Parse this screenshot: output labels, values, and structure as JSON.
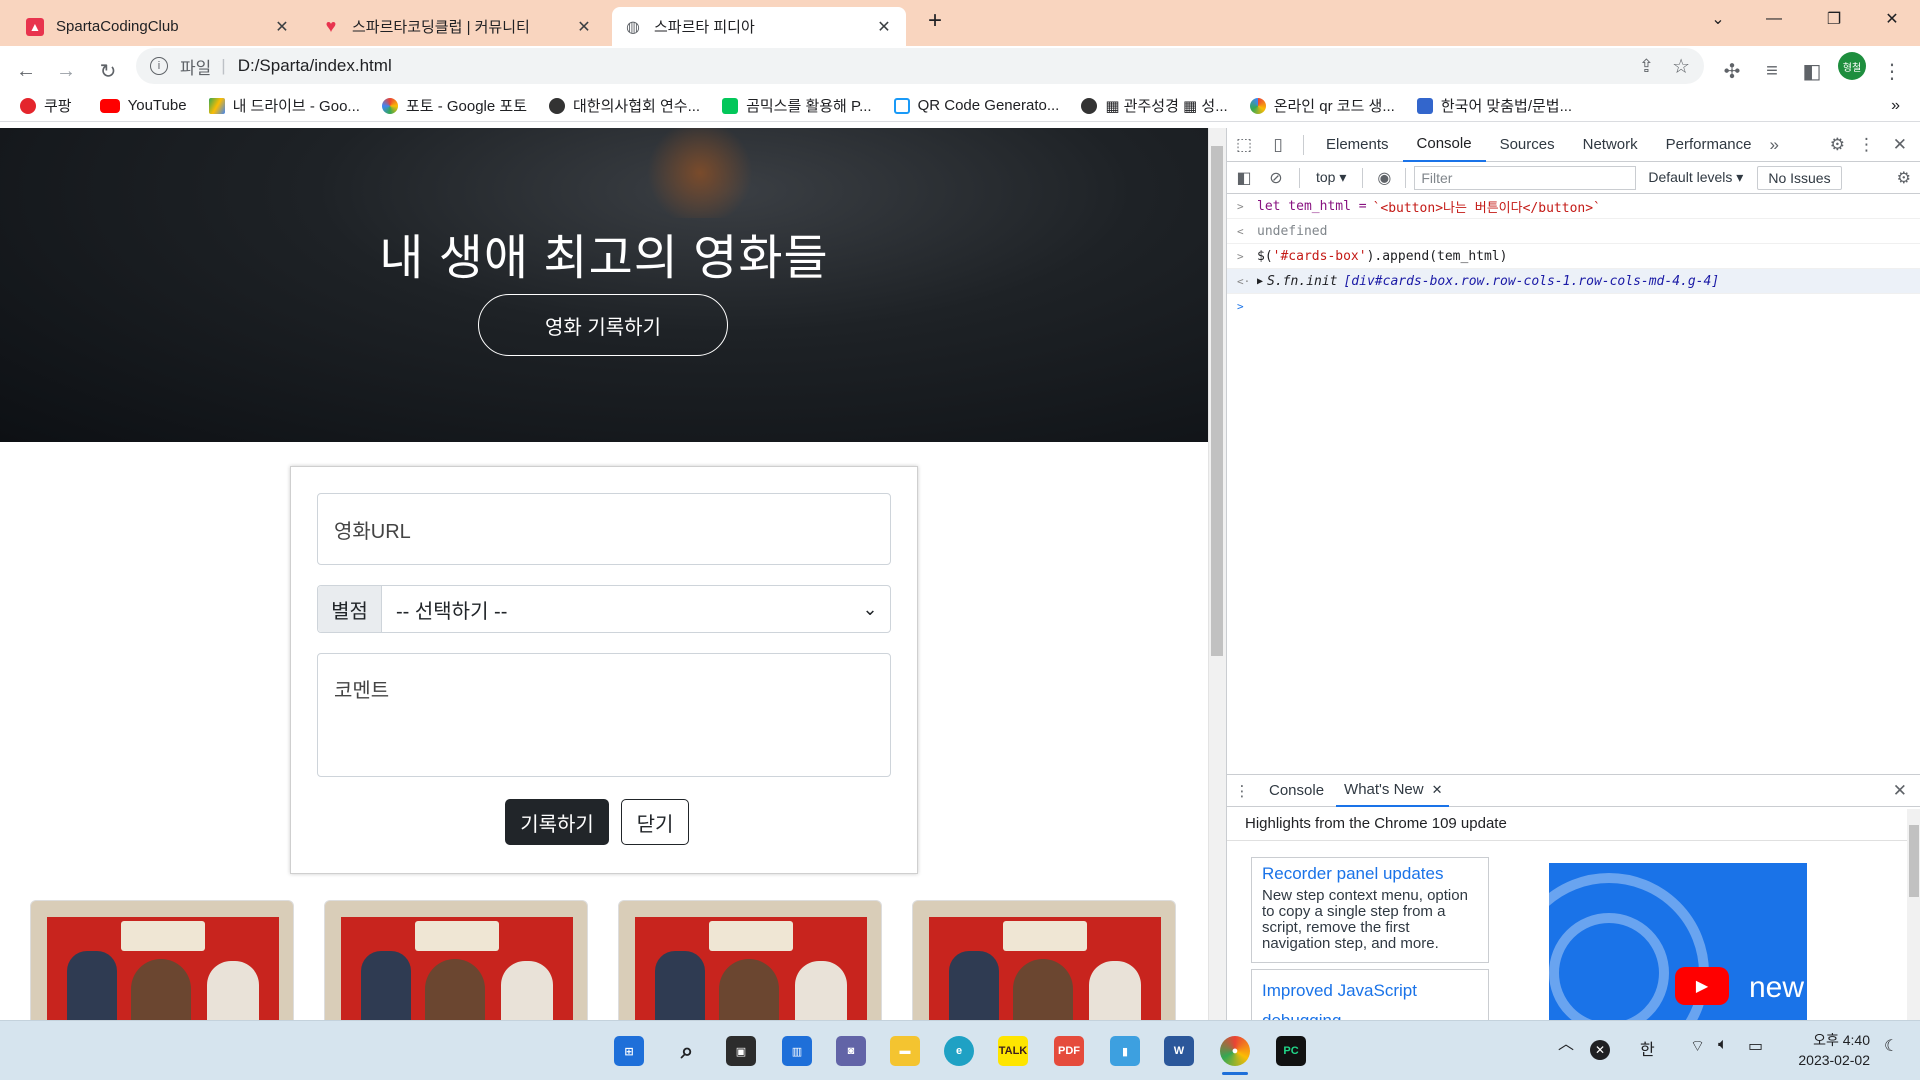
{
  "browser": {
    "tabs": [
      {
        "title": "SpartaCodingClub",
        "icon": "sparta-favicon",
        "active": false
      },
      {
        "title": "스파르타코딩클럽 | 커뮤니티",
        "icon": "heart-favicon",
        "active": false
      },
      {
        "title": "스파르타 피디아",
        "icon": "globe-icon",
        "active": true
      }
    ],
    "new_tab": "+",
    "window_controls": {
      "dropdown": "⌄",
      "minimize": "—",
      "restore": "❐",
      "close": "✕"
    },
    "address": {
      "scheme_label": "파일",
      "url": "D:/Sparta/index.html"
    },
    "profile_initials": "형철",
    "bookmarks": [
      {
        "label": "쿠팡",
        "color": "#e4252c"
      },
      {
        "label": "YouTube",
        "color": "#ff0000"
      },
      {
        "label": "내 드라이브 - Goo...",
        "color": "#34a853"
      },
      {
        "label": "포토 - Google 포토",
        "color": "#fbbc04"
      },
      {
        "label": "대한의사협회 연수...",
        "color": "#333333"
      },
      {
        "label": "곰믹스를 활용해 P...",
        "color": "#03c75a"
      },
      {
        "label": "QR Code Generato...",
        "color": "#1a9af7"
      },
      {
        "label": "▦ 관주성경 ▦ 성...",
        "color": "#333333"
      },
      {
        "label": "온라인 qr 코드 생...",
        "color": "#f29900"
      },
      {
        "label": "한국어 맞춤법/문법...",
        "color": "#3366cc"
      }
    ],
    "bookmarks_more": "»"
  },
  "page": {
    "hero_title": "내 생애 최고의 영화들",
    "hero_button": "영화 기록하기",
    "form": {
      "url_placeholder": "영화URL",
      "rating_label": "별점",
      "rating_selected": "-- 선택하기 --",
      "comment_placeholder": "코멘트",
      "submit_label": "기록하기",
      "close_label": "닫기"
    },
    "posters_count": 4
  },
  "devtools": {
    "tabs": [
      "Elements",
      "Console",
      "Sources",
      "Network",
      "Performance"
    ],
    "active_tab": "Console",
    "context": "top",
    "filter_placeholder": "Filter",
    "levels": "Default levels",
    "issues": "No Issues",
    "console_lines": [
      {
        "type": "input",
        "prefix": "let tem_html = ",
        "string": "`<button>나는 버튼이다</button>`"
      },
      {
        "type": "output",
        "text": "undefined"
      },
      {
        "type": "input",
        "prefix": "$(",
        "string": "'#cards-box'",
        "suffix": ").append(tem_html)"
      },
      {
        "type": "output-obj",
        "text": "S.fn.init ",
        "detail": "[div#cards-box.row.row-cols-1.row-cols-md-4.g-4]"
      }
    ],
    "drawer": {
      "tabs": [
        "Console",
        "What's New"
      ],
      "active": "What's New",
      "headline": "Highlights from the Chrome 109 update",
      "card1_title": "Recorder panel updates",
      "card1_body": "New step context menu, option to copy a single step from a script, remove the first navigation step, and more.",
      "card2_title": "Improved JavaScript debugging",
      "video_label": "new"
    }
  },
  "taskbar": {
    "clock_time": "오후 4:40",
    "clock_date": "2023-02-02",
    "ime": "한"
  }
}
